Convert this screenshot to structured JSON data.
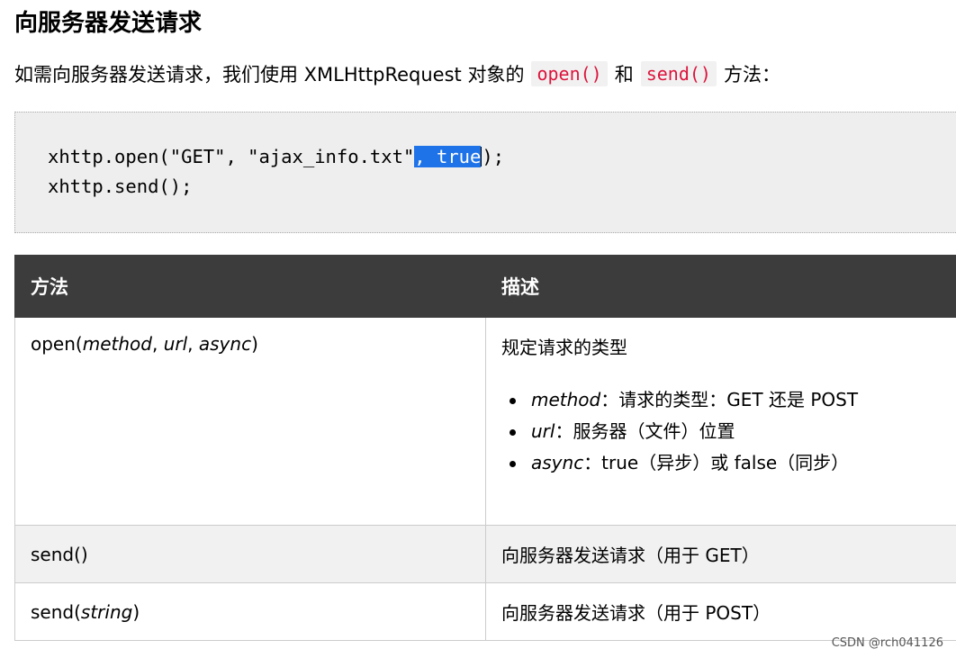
{
  "heading": "向服务器发送请求",
  "intro": {
    "before": "如需向服务器发送请求，我们使用 XMLHttpRequest 对象的",
    "code1": "open()",
    "middle": "和",
    "code2": "send()",
    "after": "方法："
  },
  "code": {
    "line1_pre": "xhttp.open(\"GET\", \"ajax_info.txt\"",
    "line1_selected": ", true",
    "line1_post": ");",
    "line2": "xhttp.send();"
  },
  "table": {
    "headers": [
      "方法",
      "描述"
    ],
    "rows": [
      {
        "method_name": "open(",
        "params": [
          "method",
          "url",
          "async"
        ],
        "method_close": ")",
        "desc": "规定请求的类型",
        "bullets": [
          {
            "term": "method",
            "text": "：请求的类型：GET 还是 POST"
          },
          {
            "term": "url",
            "text": "：服务器（文件）位置"
          },
          {
            "term": "async",
            "text": "：true（异步）或 false（同步）"
          }
        ]
      },
      {
        "method": "send()",
        "desc": "向服务器发送请求（用于 GET）"
      },
      {
        "method_name": "send(",
        "param": "string",
        "method_close": ")",
        "desc": "向服务器发送请求（用于 POST）"
      }
    ]
  },
  "watermark": "CSDN @rch041126"
}
